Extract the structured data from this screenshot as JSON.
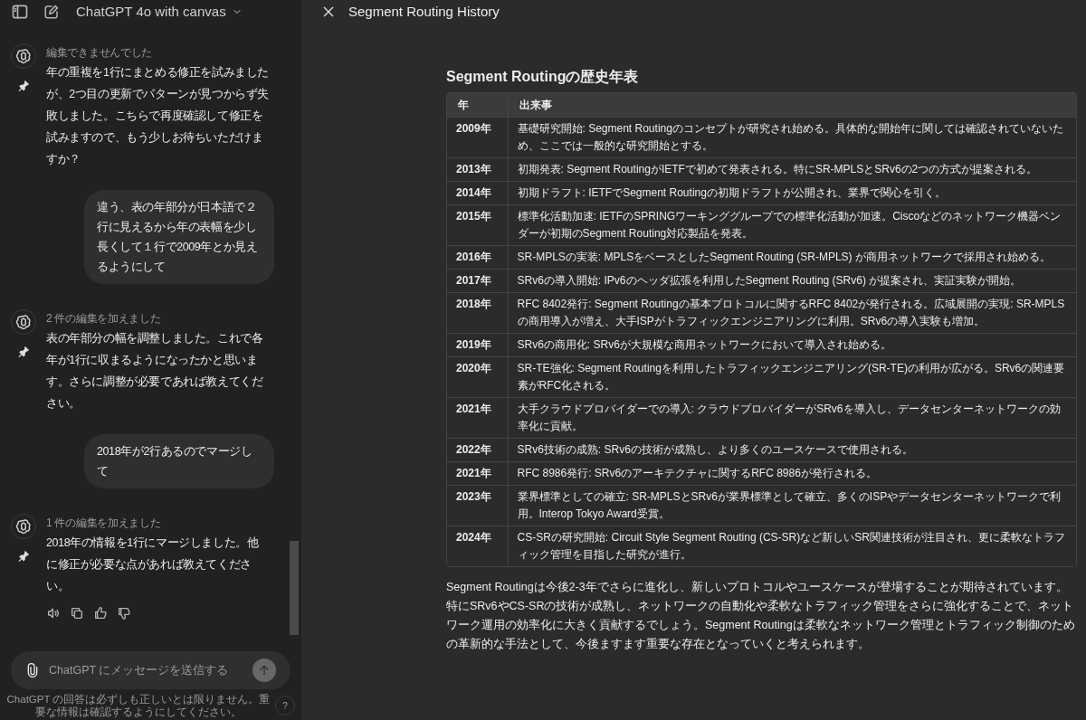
{
  "header": {
    "model": "ChatGPT 4o with canvas"
  },
  "messages": [
    {
      "kind": "assistant",
      "status": "編集できませんでした",
      "text": "年の重複を1行にまとめる修正を試みましたが、2つ目の更新でパターンが見つからず失敗しました。こちらで再度確認して修正を試みますので、もう少しお待ちいただけますか？",
      "actions": false
    },
    {
      "kind": "user",
      "text": "違う、表の年部分が日本語で２行に見えるから年の表幅を少し長くして１行で2009年とか見えるようにして"
    },
    {
      "kind": "assistant",
      "status": "2 件の編集を加えました",
      "text": "表の年部分の幅を調整しました。これで各年が1行に収まるようになったかと思います。さらに調整が必要であれば教えてください。",
      "actions": false
    },
    {
      "kind": "user",
      "text": "2018年が2行あるのでマージして"
    },
    {
      "kind": "assistant",
      "status": "1 件の編集を加えました",
      "text": "2018年の情報を1行にマージしました。他に修正が必要な点があれば教えてください。",
      "actions": true
    }
  ],
  "composer": {
    "placeholder": "ChatGPT にメッセージを送信する"
  },
  "disclaimer": "ChatGPT の回答は必ずしも正しいとは限りません。重要な情報は確認するようにしてください。",
  "help": "?",
  "canvas": {
    "title": "Segment Routing History",
    "heading": "Segment Routingの歴史年表",
    "columns": [
      "年",
      "出来事"
    ],
    "rows": [
      {
        "year": "2009年",
        "event": "基礎研究開始: Segment Routingのコンセプトが研究され始める。具体的な開始年に関しては確認されていないため、ここでは一般的な研究開始とする。"
      },
      {
        "year": "2013年",
        "event": "初期発表: Segment RoutingがIETFで初めて発表される。特にSR-MPLSとSRv6の2つの方式が提案される。"
      },
      {
        "year": "2014年",
        "event": "初期ドラフト: IETFでSegment Routingの初期ドラフトが公開され、業界で関心を引く。"
      },
      {
        "year": "2015年",
        "event": "標準化活動加速: IETFのSPRINGワーキンググループでの標準化活動が加速。Ciscoなどのネットワーク機器ベンダーが初期のSegment Routing対応製品を発表。"
      },
      {
        "year": "2016年",
        "event": "SR-MPLSの実装: MPLSをベースとしたSegment Routing (SR-MPLS) が商用ネットワークで採用され始める。"
      },
      {
        "year": "2017年",
        "event": "SRv6の導入開始: IPv6のヘッダ拡張を利用したSegment Routing (SRv6) が提案され、実証実験が開始。"
      },
      {
        "year": "2018年",
        "event": "RFC 8402発行: Segment Routingの基本プロトコルに関するRFC 8402が発行される。広域展開の実現: SR-MPLSの商用導入が増え、大手ISPがトラフィックエンジニアリングに利用。SRv6の導入実験も増加。"
      },
      {
        "year": "2019年",
        "event": "SRv6の商用化: SRv6が大規模な商用ネットワークにおいて導入され始める。"
      },
      {
        "year": "2020年",
        "event": "SR-TE強化: Segment Routingを利用したトラフィックエンジニアリング(SR-TE)の利用が広がる。SRv6の関連要素がRFC化される。"
      },
      {
        "year": "2021年",
        "event": "大手クラウドプロバイダーでの導入: クラウドプロバイダーがSRv6を導入し、データセンターネットワークの効率化に貢献。"
      },
      {
        "year": "2022年",
        "event": "SRv6技術の成熟: SRv6の技術が成熟し、より多くのユースケースで使用される。"
      },
      {
        "year": "2021年",
        "event": "RFC 8986発行: SRv6のアーキテクチャに関するRFC 8986が発行される。"
      },
      {
        "year": "2023年",
        "event": "業界標準としての確立: SR-MPLSとSRv6が業界標準として確立、多くのISPやデータセンターネットワークで利用。Interop Tokyo Award受賞。"
      },
      {
        "year": "2024年",
        "event": "CS-SRの研究開始: Circuit Style Segment Routing (CS-SR)など新しいSR関連技術が注目され、更に柔軟なトラフィック管理を目指した研究が進行。"
      }
    ],
    "paragraph": "Segment Routingは今後2-3年でさらに進化し、新しいプロトコルやユースケースが登場することが期待されています。特にSRv6やCS-SRの技術が成熟し、ネットワークの自動化や柔軟なトラフィック管理をさらに強化することで、ネットワーク運用の効率化に大きく貢献するでしょう。Segment Routingは柔軟なネットワーク管理とトラフィック制御のための革新的な手法として、今後ますます重要な存在となっていくと考えられます。"
  }
}
